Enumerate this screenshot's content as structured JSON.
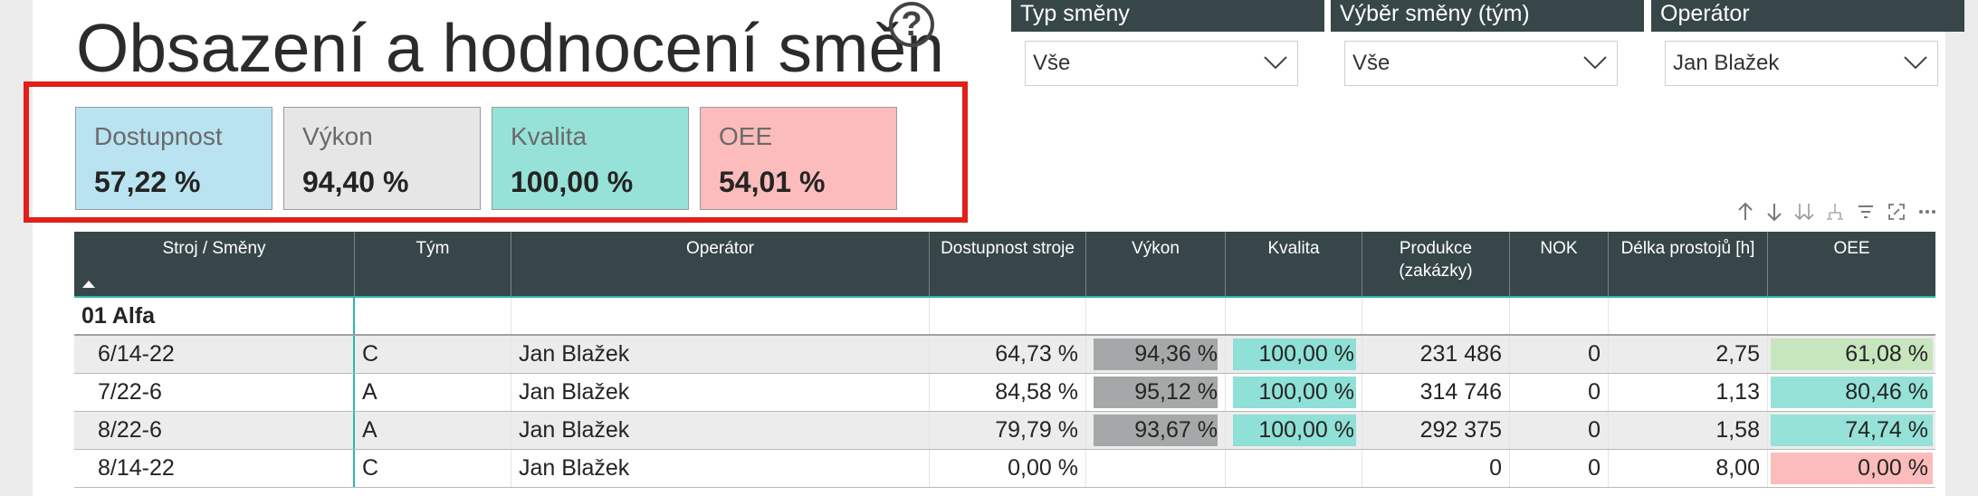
{
  "title": "Obsazení a hodnocení směn",
  "help_glyph": "?",
  "slicers": [
    {
      "label": "Typ směny",
      "value": "Vše"
    },
    {
      "label": "Výběr směny  (tým)",
      "value": "Vše"
    },
    {
      "label": "Operátor",
      "value": "Jan Blažek"
    }
  ],
  "kpis": [
    {
      "label": "Dostupnost",
      "value": "57,22 %",
      "bg": "#b9e3f0"
    },
    {
      "label": "Výkon",
      "value": "94,40 %",
      "bg": "#e6e6e6"
    },
    {
      "label": "Kvalita",
      "value": "100,00 %",
      "bg": "#96e2d8"
    },
    {
      "label": "OEE",
      "value": "54,01 %",
      "bg": "#fcbcbc"
    }
  ],
  "table": {
    "headers": [
      "Stroj / Směny",
      "Tým",
      "Operátor",
      "Dostupnost stroje",
      "Výkon",
      "Kvalita",
      "Produkce\n(zakázky)",
      "NOK",
      "Délka prostojů [h]",
      "OEE"
    ],
    "group": "01 Alfa",
    "rows": [
      {
        "shift": "6/14-22",
        "team": "C",
        "operator": "Jan Blažek",
        "avail": "64,73 %",
        "perf": "94,36 %",
        "quality": "100,00 %",
        "production": "231 486",
        "nok": "0",
        "downtime": "2,75",
        "oee": "61,08 %",
        "oee_bg": "#c7e6bd"
      },
      {
        "shift": "7/22-6",
        "team": "A",
        "operator": "Jan Blažek",
        "avail": "84,58 %",
        "perf": "95,12 %",
        "quality": "100,00 %",
        "production": "314 746",
        "nok": "0",
        "downtime": "1,13",
        "oee": "80,46 %",
        "oee_bg": "#96e2d8"
      },
      {
        "shift": "8/22-6",
        "team": "A",
        "operator": "Jan Blažek",
        "avail": "79,79 %",
        "perf": "93,67 %",
        "quality": "100,00 %",
        "production": "292 375",
        "nok": "0",
        "downtime": "1,58",
        "oee": "74,74 %",
        "oee_bg": "#96e2d8"
      },
      {
        "shift": "8/14-22",
        "team": "C",
        "operator": "Jan Blažek",
        "avail": "0,00 %",
        "perf": "",
        "quality": "",
        "production": "0",
        "nok": "0",
        "downtime": "8,00",
        "oee": "0,00 %",
        "oee_bg": "#fcbcbc"
      }
    ]
  },
  "toolbar_icons": [
    "sort-ascending-icon",
    "sort-descending-icon",
    "expand-all-icon",
    "drill-icon",
    "filter-icon",
    "focus-mode-icon",
    "more-options-icon"
  ]
}
